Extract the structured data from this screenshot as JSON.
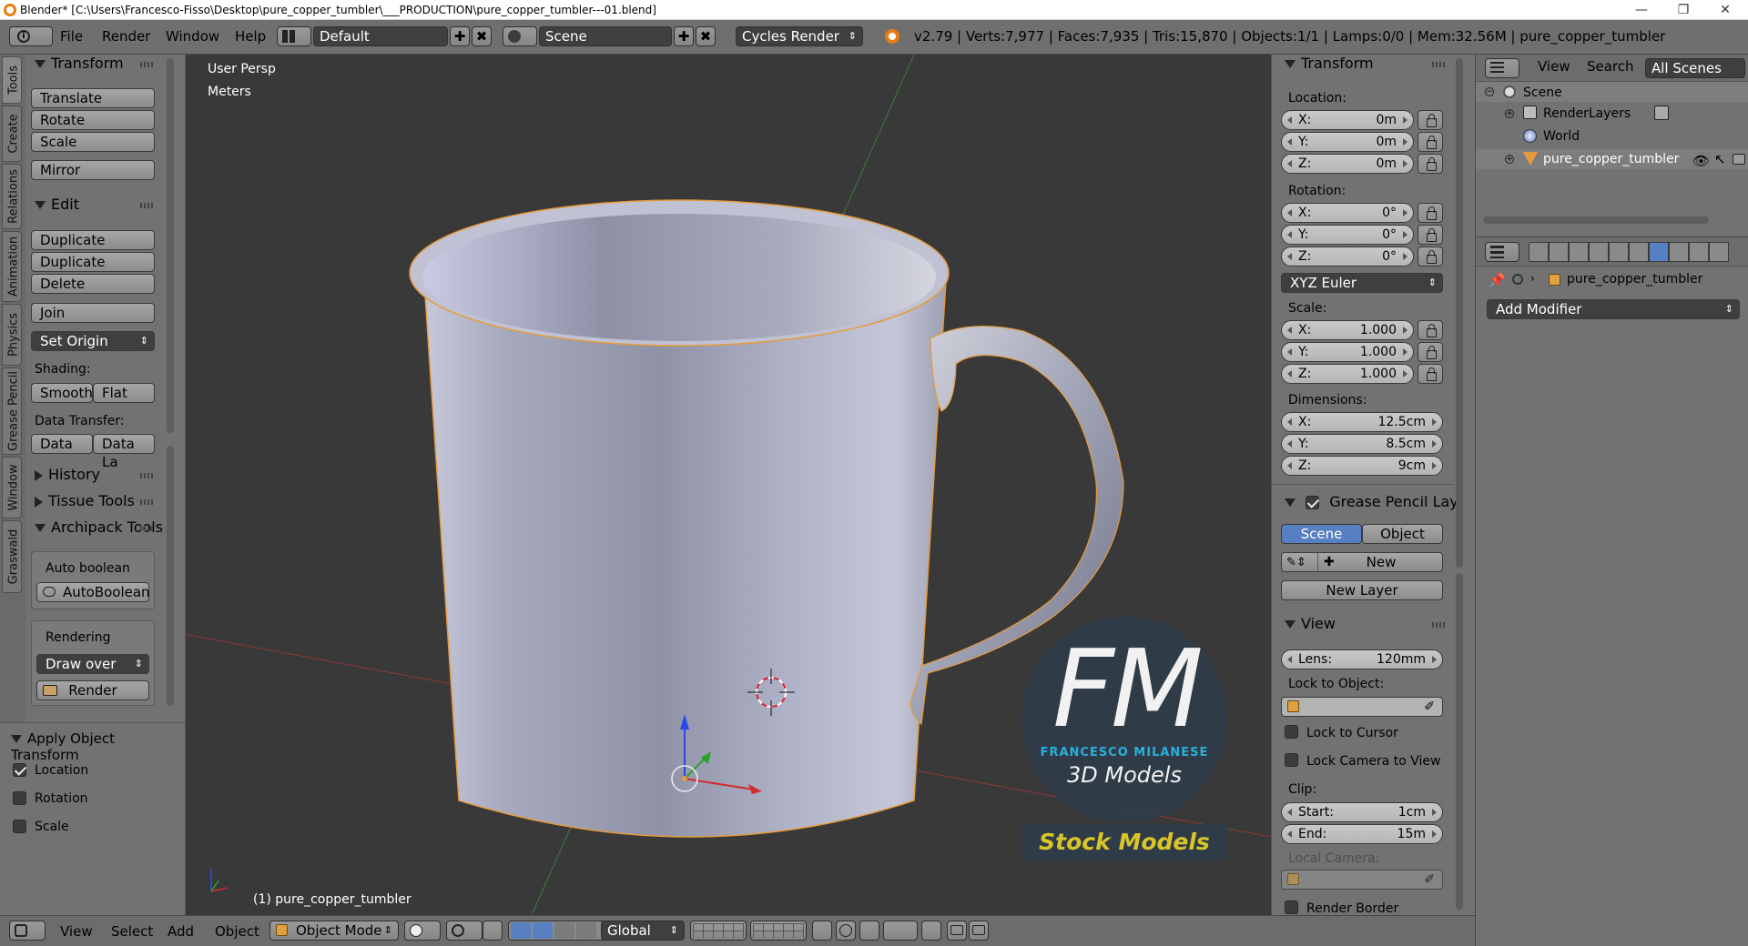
{
  "window": {
    "title": "Blender* [C:\\Users\\Francesco-Fisso\\Desktop\\pure_copper_tumbler\\___PRODUCTION\\pure_copper_tumbler---01.blend]",
    "minimize": "—",
    "maximize": "❐",
    "close": "✕"
  },
  "info_bar": {
    "menus": [
      "File",
      "Render",
      "Window",
      "Help"
    ],
    "layout": "Default",
    "scene": "Scene",
    "engine": "Cycles Render",
    "stats": "v2.79 | Verts:7,977 | Faces:7,935 | Tris:15,870 | Objects:1/1 | Lamps:0/0 | Mem:32.56M | pure_copper_tumbler"
  },
  "tool_tabs": [
    "Tools",
    "Create",
    "Relations",
    "Animation",
    "Physics",
    "Grease Pencil",
    "Window",
    "Graswald"
  ],
  "tool_shelf": {
    "transform": {
      "title": "Transform",
      "buttons": [
        "Translate",
        "Rotate",
        "Scale",
        "Mirror"
      ]
    },
    "edit": {
      "title": "Edit",
      "buttons": [
        "Duplicate",
        "Duplicate Linked",
        "Delete",
        "Join"
      ],
      "set_origin": "Set Origin"
    },
    "shading": {
      "label": "Shading:",
      "smooth": "Smooth",
      "flat": "Flat"
    },
    "data_transfer": {
      "label": "Data Transfer:",
      "data": "Data",
      "data_la": "Data La"
    },
    "history": "History",
    "tissue": "Tissue Tools",
    "archipack": {
      "title": "Archipack Tools",
      "auto_boolean_label": "Auto boolean",
      "auto_boolean_btn": "AutoBoolean",
      "rendering_label": "Rendering",
      "draw_over": "Draw over",
      "render_btn": "Render"
    }
  },
  "operator_panel": {
    "title": "Apply Object Transform",
    "options": [
      {
        "label": "Location",
        "checked": true
      },
      {
        "label": "Rotation",
        "checked": false
      },
      {
        "label": "Scale",
        "checked": false
      }
    ]
  },
  "viewport": {
    "view_name": "User Persp",
    "units": "Meters",
    "object_label": "(1) pure_copper_tumbler",
    "watermark": {
      "initials": "FM",
      "name": "FRANCESCO MILANESE",
      "sub": "3D Models",
      "banner": "Stock Models"
    }
  },
  "properties_n": {
    "transform_title": "Transform",
    "location_label": "Location:",
    "location": [
      {
        "k": "X:",
        "v": "0m"
      },
      {
        "k": "Y:",
        "v": "0m"
      },
      {
        "k": "Z:",
        "v": "0m"
      }
    ],
    "rotation_label": "Rotation:",
    "rotation": [
      {
        "k": "X:",
        "v": "0°"
      },
      {
        "k": "Y:",
        "v": "0°"
      },
      {
        "k": "Z:",
        "v": "0°"
      }
    ],
    "rotation_mode": "XYZ Euler",
    "scale_label": "Scale:",
    "scale": [
      {
        "k": "X:",
        "v": "1.000"
      },
      {
        "k": "Y:",
        "v": "1.000"
      },
      {
        "k": "Z:",
        "v": "1.000"
      }
    ],
    "dimensions_label": "Dimensions:",
    "dimensions": [
      {
        "k": "X:",
        "v": "12.5cm"
      },
      {
        "k": "Y:",
        "v": "8.5cm"
      },
      {
        "k": "Z:",
        "v": "9cm"
      }
    ],
    "grease_title": "Grease Pencil Layer",
    "grease_scene": "Scene",
    "grease_object": "Object",
    "grease_new": "New",
    "grease_new_layer": "New Layer",
    "view_title": "View",
    "lens": {
      "k": "Lens:",
      "v": "120mm"
    },
    "lock_to_object": "Lock to Object:",
    "lock_to_cursor": "Lock to Cursor",
    "lock_camera": "Lock Camera to View",
    "clip_label": "Clip:",
    "clip_start": {
      "k": "Start:",
      "v": "1cm"
    },
    "clip_end": {
      "k": "End:",
      "v": "15m"
    },
    "local_camera": "Local Camera:",
    "render_border": "Render Border"
  },
  "outliner": {
    "view": "View",
    "search": "Search",
    "filter": "All Scenes",
    "items": [
      {
        "label": "Scene"
      },
      {
        "label": "RenderLayers"
      },
      {
        "label": "World"
      },
      {
        "label": "pure_copper_tumbler"
      }
    ]
  },
  "properties_editor": {
    "object_name": "pure_copper_tumbler",
    "add_modifier": "Add Modifier"
  },
  "bottom_bar": {
    "menus": [
      "View",
      "Select",
      "Add",
      "Object"
    ],
    "mode": "Object Mode",
    "orientation": "Global"
  },
  "colors": {
    "viewport_bg": "#393939",
    "panel_bg": "#727272",
    "selected_blue": "#5680c2",
    "mug": "#a9adc7",
    "watermark_circle": "#2f3d4a",
    "watermark_cyan": "#29b7e8",
    "banner_yellow": "#e7d027"
  }
}
